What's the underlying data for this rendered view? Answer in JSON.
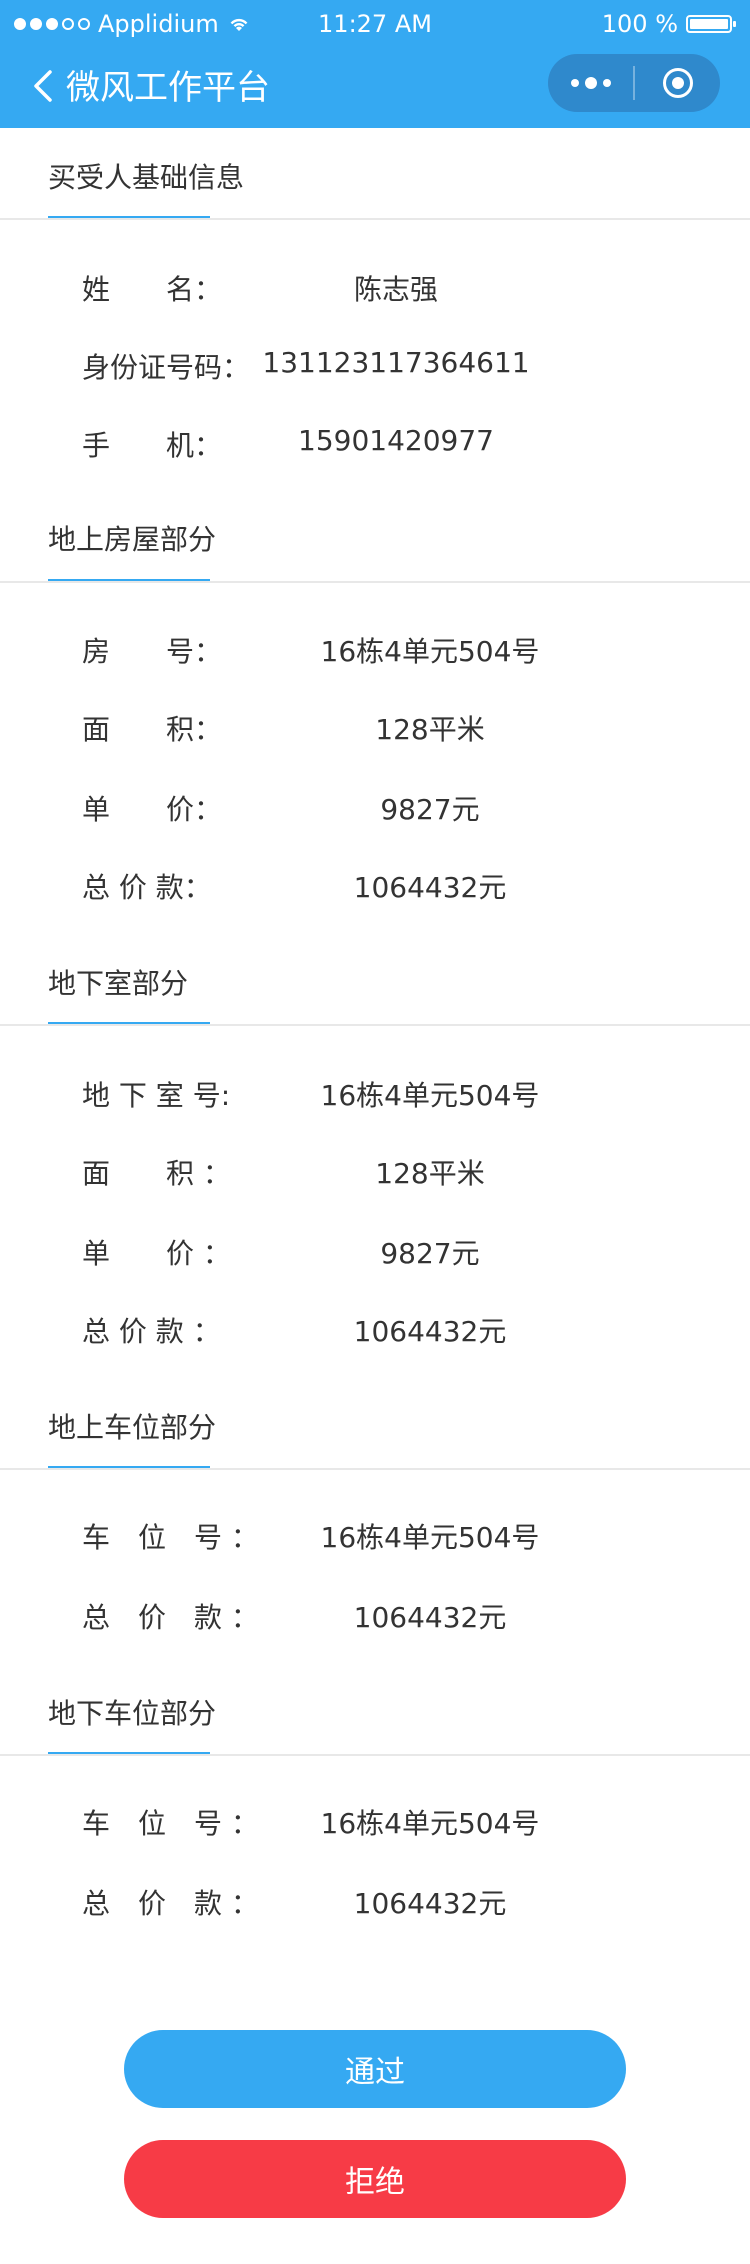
{
  "status_bar": {
    "carrier": "Applidium",
    "time": "11:27 AM",
    "battery": "100 %",
    "battery_level_percent": 100
  },
  "nav": {
    "title": "微风工作平台"
  },
  "sections": [
    {
      "title": "买受人基础信息",
      "rows": [
        {
          "label": "姓　　名：",
          "value": "陈志强"
        },
        {
          "label": "身份证号码：",
          "value": "131123117364611"
        },
        {
          "label": "手　　机：",
          "value": "15901420977"
        }
      ]
    },
    {
      "title": "地上房屋部分",
      "rows": [
        {
          "label": "房　　号：",
          "value": "16栋4单元504号"
        },
        {
          "label": "面　　积：",
          "value": "128平米"
        },
        {
          "label": "单　　价：",
          "value": "9827元"
        },
        {
          "label": "总 价 款：",
          "value": "1064432元"
        }
      ]
    },
    {
      "title": "地下室部分",
      "rows": [
        {
          "label": "地 下 室 号:",
          "value": "16栋4单元504号"
        },
        {
          "label": "面　　积 ：",
          "value": "128平米"
        },
        {
          "label": "单　　价 ：",
          "value": "9827元"
        },
        {
          "label": "总 价 款 ：",
          "value": "1064432元"
        }
      ]
    },
    {
      "title": "地上车位部分",
      "rows": [
        {
          "label": "车　位　号 ：",
          "value": "16栋4单元504号"
        },
        {
          "label": "总　价　款 ：",
          "value": "1064432元"
        }
      ]
    },
    {
      "title": "地下车位部分",
      "rows": [
        {
          "label": "车　位　号 ：",
          "value": "16栋4单元504号"
        },
        {
          "label": "总　价　款 ：",
          "value": "1064432元"
        }
      ]
    }
  ],
  "buttons": {
    "pass": "通过",
    "reject": "拒绝"
  },
  "colors": {
    "primary": "#35a9f2",
    "danger": "#f73b46",
    "capsule": "#2f89cc"
  }
}
